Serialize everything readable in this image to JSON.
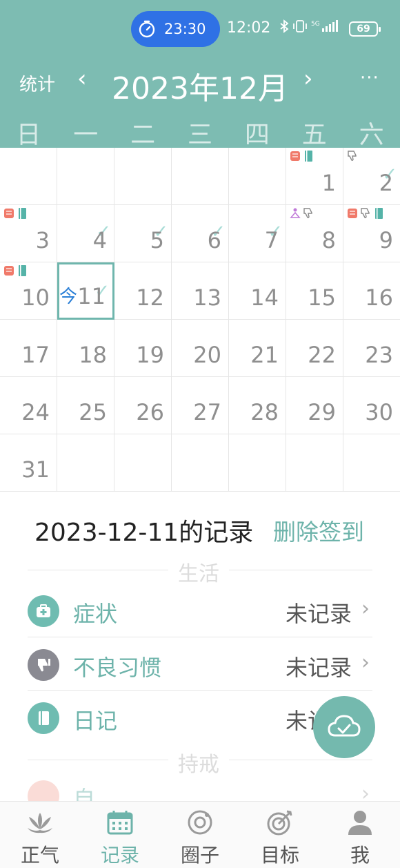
{
  "status_bar": {
    "timer": "23:30",
    "clock": "12:02",
    "battery": "69"
  },
  "header": {
    "stats_label": "统计",
    "prev_label": "‹",
    "next_label": "›",
    "month_title": "2023年12月",
    "more_label": "···",
    "weekdays": [
      "日",
      "一",
      "二",
      "三",
      "四",
      "五",
      "六"
    ]
  },
  "calendar": {
    "today_mark": "今",
    "days": [
      {
        "day": "1",
        "icons": [
          "reading",
          "book"
        ],
        "check": false
      },
      {
        "day": "2",
        "icons": [
          "thumbs-down"
        ],
        "check": true
      },
      {
        "day": "3",
        "icons": [
          "reading",
          "book"
        ],
        "check": false
      },
      {
        "day": "4",
        "icons": [],
        "check": true
      },
      {
        "day": "5",
        "icons": [],
        "check": true
      },
      {
        "day": "6",
        "icons": [],
        "check": true
      },
      {
        "day": "7",
        "icons": [],
        "check": true
      },
      {
        "day": "8",
        "icons": [
          "meditation",
          "thumbs-down"
        ],
        "check": false
      },
      {
        "day": "9",
        "icons": [
          "reading",
          "thumbs-down",
          "book"
        ],
        "check": false
      },
      {
        "day": "10",
        "icons": [
          "reading",
          "book"
        ],
        "check": false
      },
      {
        "day": "11",
        "icons": [],
        "check": true,
        "today": true
      },
      {
        "day": "12"
      },
      {
        "day": "13"
      },
      {
        "day": "14"
      },
      {
        "day": "15"
      },
      {
        "day": "16"
      },
      {
        "day": "17"
      },
      {
        "day": "18"
      },
      {
        "day": "19"
      },
      {
        "day": "20"
      },
      {
        "day": "21"
      },
      {
        "day": "22"
      },
      {
        "day": "23"
      },
      {
        "day": "24"
      },
      {
        "day": "25"
      },
      {
        "day": "26"
      },
      {
        "day": "27"
      },
      {
        "day": "28"
      },
      {
        "day": "29"
      },
      {
        "day": "30"
      },
      {
        "day": "31"
      }
    ]
  },
  "record": {
    "title": "2023-12-11的记录",
    "delete_label": "删除签到"
  },
  "sections": {
    "life": "生活",
    "precepts": "持戒"
  },
  "items": [
    {
      "label": "症状",
      "status": "未记录",
      "color": "#6fbcb1",
      "icon": "first-aid-icon"
    },
    {
      "label": "不良习惯",
      "status": "未记录",
      "color": "#8a8a92",
      "icon": "thumbs-down-icon"
    },
    {
      "label": "日记",
      "status": "未记录",
      "color": "#6fbcb1",
      "icon": "diary-icon"
    },
    {
      "label": "自",
      "status": "",
      "color": "#f4b3a8",
      "icon": "reading-icon"
    }
  ],
  "bottom_nav": [
    {
      "label": "正气",
      "icon": "lotus-icon",
      "active": false
    },
    {
      "label": "记录",
      "icon": "calendar-icon",
      "active": true
    },
    {
      "label": "圈子",
      "icon": "circle-icon",
      "active": false
    },
    {
      "label": "目标",
      "icon": "target-icon",
      "active": false
    },
    {
      "label": "我",
      "icon": "profile-icon",
      "active": false
    }
  ],
  "colors": {
    "header_bg": "#7dbcb2",
    "accent": "#6db3aa",
    "timer_pill": "#2f71e5"
  }
}
